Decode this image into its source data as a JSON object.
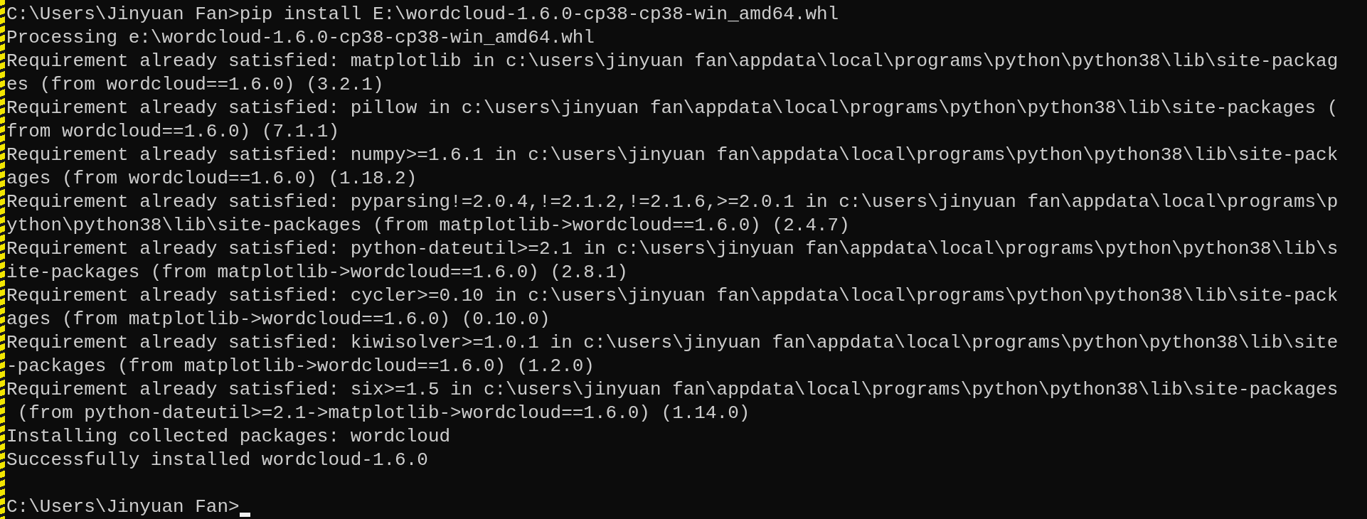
{
  "terminal": {
    "lines": [
      "C:\\Users\\Jinyuan Fan>pip install E:\\wordcloud-1.6.0-cp38-cp38-win_amd64.whl",
      "Processing e:\\wordcloud-1.6.0-cp38-cp38-win_amd64.whl",
      "Requirement already satisfied: matplotlib in c:\\users\\jinyuan fan\\appdata\\local\\programs\\python\\python38\\lib\\site-packag",
      "es (from wordcloud==1.6.0) (3.2.1)",
      "Requirement already satisfied: pillow in c:\\users\\jinyuan fan\\appdata\\local\\programs\\python\\python38\\lib\\site-packages (",
      "from wordcloud==1.6.0) (7.1.1)",
      "Requirement already satisfied: numpy>=1.6.1 in c:\\users\\jinyuan fan\\appdata\\local\\programs\\python\\python38\\lib\\site-pack",
      "ages (from wordcloud==1.6.0) (1.18.2)",
      "Requirement already satisfied: pyparsing!=2.0.4,!=2.1.2,!=2.1.6,>=2.0.1 in c:\\users\\jinyuan fan\\appdata\\local\\programs\\p",
      "ython\\python38\\lib\\site-packages (from matplotlib->wordcloud==1.6.0) (2.4.7)",
      "Requirement already satisfied: python-dateutil>=2.1 in c:\\users\\jinyuan fan\\appdata\\local\\programs\\python\\python38\\lib\\s",
      "ite-packages (from matplotlib->wordcloud==1.6.0) (2.8.1)",
      "Requirement already satisfied: cycler>=0.10 in c:\\users\\jinyuan fan\\appdata\\local\\programs\\python\\python38\\lib\\site-pack",
      "ages (from matplotlib->wordcloud==1.6.0) (0.10.0)",
      "Requirement already satisfied: kiwisolver>=1.0.1 in c:\\users\\jinyuan fan\\appdata\\local\\programs\\python\\python38\\lib\\site",
      "-packages (from matplotlib->wordcloud==1.6.0) (1.2.0)",
      "Requirement already satisfied: six>=1.5 in c:\\users\\jinyuan fan\\appdata\\local\\programs\\python\\python38\\lib\\site-packages",
      " (from python-dateutil>=2.1->matplotlib->wordcloud==1.6.0) (1.14.0)",
      "Installing collected packages: wordcloud",
      "Successfully installed wordcloud-1.6.0"
    ],
    "prompt": "C:\\Users\\Jinyuan Fan>",
    "cursor": true
  }
}
